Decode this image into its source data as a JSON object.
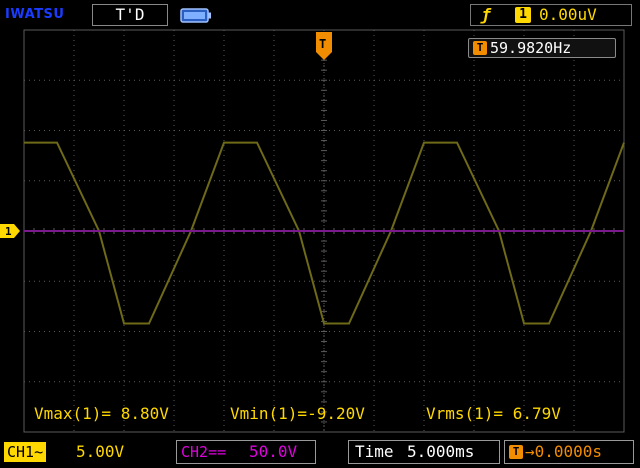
{
  "header": {
    "brand": "IWATSU",
    "acq_state": "T'D",
    "battery_icon": "battery-icon",
    "trigger": {
      "edge_symbol": "ƒ",
      "source": "1",
      "level": "0.00uV"
    }
  },
  "frequency_counter": {
    "icon_letter": "T",
    "value": "59.9820Hz"
  },
  "measurements": [
    {
      "label": "Vmax(1)=",
      "value": " 8.80V"
    },
    {
      "label": "Vmin(1)=",
      "value": "-9.20V"
    },
    {
      "label": "Vrms(1)=",
      "value": " 6.79V"
    }
  ],
  "footer": {
    "ch1": {
      "label": "CH1~",
      "scale": "5.00V"
    },
    "ch2": {
      "label": "CH2==",
      "scale": "50.0V"
    },
    "timebase": {
      "label": "Time",
      "value": "5.000ms"
    },
    "trigger_delay": {
      "icon_letter": "T",
      "value": "→0.0000s"
    }
  },
  "markers": {
    "ch1_marker_label": "1",
    "trigger_marker_label": "T"
  },
  "colors": {
    "background": "#000000",
    "brand": "#1a3cff",
    "ch1": "#ffd800",
    "ch1_trace": "#6e6a18",
    "ch2": "#e000e0",
    "ch2_trace": "#7a1a8c",
    "trigger": "#f28c00",
    "grid": "#5a5a5a"
  },
  "chart_data": {
    "type": "line",
    "series": [
      {
        "name": "CH1",
        "x": [
          0,
          3.3,
          7.5,
          10,
          12.5,
          16.7,
          20,
          23.3,
          27.5,
          30,
          32.5,
          36.7,
          40,
          43.3,
          47.5,
          50,
          52.5,
          56.7,
          60
        ],
        "values": [
          8.8,
          8.8,
          0,
          -9.2,
          -9.2,
          0,
          8.8,
          8.8,
          0,
          -9.2,
          -9.2,
          0,
          8.8,
          8.8,
          0,
          -9.2,
          -9.2,
          0,
          8.8
        ]
      },
      {
        "name": "CH2",
        "x": [
          0,
          60
        ],
        "values": [
          0,
          0
        ]
      }
    ],
    "xlim": [
      0,
      60
    ],
    "ylim": [
      -20,
      20
    ],
    "grid": true
  }
}
